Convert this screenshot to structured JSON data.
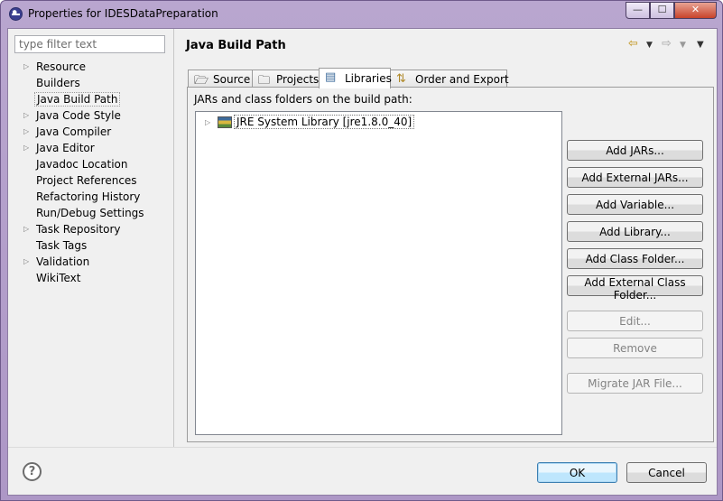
{
  "window": {
    "title": "Properties for IDESDataPreparation",
    "min_glyph": "—",
    "max_glyph": "☐",
    "close_glyph": "✕"
  },
  "filter": {
    "placeholder": "type filter text",
    "value": ""
  },
  "nav": {
    "items": [
      {
        "label": "Resource",
        "expandable": true,
        "selected": false
      },
      {
        "label": "Builders",
        "expandable": false,
        "selected": false
      },
      {
        "label": "Java Build Path",
        "expandable": false,
        "selected": true
      },
      {
        "label": "Java Code Style",
        "expandable": true,
        "selected": false
      },
      {
        "label": "Java Compiler",
        "expandable": true,
        "selected": false
      },
      {
        "label": "Java Editor",
        "expandable": true,
        "selected": false
      },
      {
        "label": "Javadoc Location",
        "expandable": false,
        "selected": false
      },
      {
        "label": "Project References",
        "expandable": false,
        "selected": false
      },
      {
        "label": "Refactoring History",
        "expandable": false,
        "selected": false
      },
      {
        "label": "Run/Debug Settings",
        "expandable": false,
        "selected": false
      },
      {
        "label": "Task Repository",
        "expandable": true,
        "selected": false
      },
      {
        "label": "Task Tags",
        "expandable": false,
        "selected": false
      },
      {
        "label": "Validation",
        "expandable": true,
        "selected": false
      },
      {
        "label": "WikiText",
        "expandable": false,
        "selected": false
      }
    ]
  },
  "page": {
    "title": "Java Build Path",
    "history": {
      "back_icon": "back-arrow-icon",
      "forward_icon": "forward-arrow-icon"
    }
  },
  "tabs": [
    {
      "label": "Source",
      "icon": "source-folder-icon",
      "active": false
    },
    {
      "label": "Projects",
      "icon": "project-folder-icon",
      "active": false
    },
    {
      "label": "Libraries",
      "icon": "library-icon",
      "active": true
    },
    {
      "label": "Order and Export",
      "icon": "order-export-icon",
      "active": false
    }
  ],
  "libraries": {
    "caption": "JARs and class folders on the build path:",
    "entries": [
      {
        "label": "JRE System Library [jre1.8.0_40]",
        "icon": "library-icon"
      }
    ]
  },
  "buttons": {
    "add_jars": "Add JARs...",
    "add_external_jars": "Add External JARs...",
    "add_variable": "Add Variable...",
    "add_library": "Add Library...",
    "add_class_folder": "Add Class Folder...",
    "add_external_class_folder": "Add External Class Folder...",
    "edit": "Edit...",
    "remove": "Remove",
    "migrate_jar": "Migrate JAR File..."
  },
  "dialog": {
    "help_glyph": "?",
    "ok": "OK",
    "cancel": "Cancel"
  },
  "colors": {
    "title_bar": "#b9a6cf",
    "ok_border": "#3c7fb1",
    "disabled_text": "#838383"
  }
}
